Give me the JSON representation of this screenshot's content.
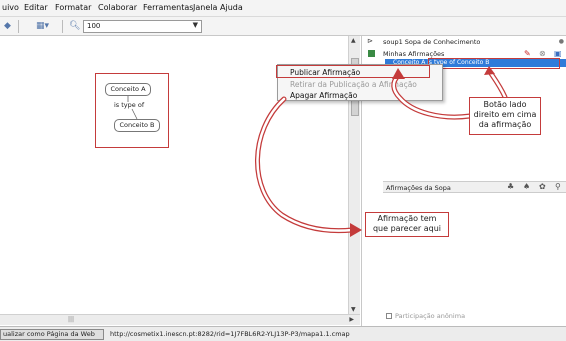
{
  "menubar": {
    "items": [
      "uivo",
      "Editar",
      "Formatar",
      "Colaborar",
      "Ferramentas",
      "Janela",
      "Ajuda"
    ]
  },
  "toolbar": {
    "zoom_value": "100",
    "icons": [
      "diamond-icon",
      "toggle-icon",
      "zoom-icon",
      "dropdown-icon"
    ]
  },
  "concept_map": {
    "concept_a": "Conceito A",
    "linking_phrase": "is type of",
    "concept_b": "Conceito B"
  },
  "context_menu": {
    "publish": "Publicar Afirmação",
    "unpublish": "Retirar da Publicação a Afirmação",
    "delete": "Apagar Afirmação"
  },
  "right_panel": {
    "kb_label": "soup1 Sopa de Conhecimento",
    "my_claims": "Minhas Afirmações",
    "selected_claim": "Conceito A is type of Conceito B",
    "soup_header": "Afirmações da Sopa",
    "anonymous": "Participação anônima"
  },
  "callouts": {
    "right_side": [
      "Botão lado",
      "direito em cima",
      "da afirmação"
    ],
    "appear_here": [
      "Afirmação tem",
      "que parecer aqui"
    ]
  },
  "statusbar": {
    "web_button": "ualizar como Página da Web",
    "url": "http://cosmetix1.inescn.pt:8282/rid=1J7FBL6R2-YLJ13P-P3/mapa1.1.cmap"
  },
  "colors": {
    "highlight_red": "#c43b3b",
    "selection_blue": "#2f7bd9",
    "panel_bg": "#f4f4f4"
  }
}
